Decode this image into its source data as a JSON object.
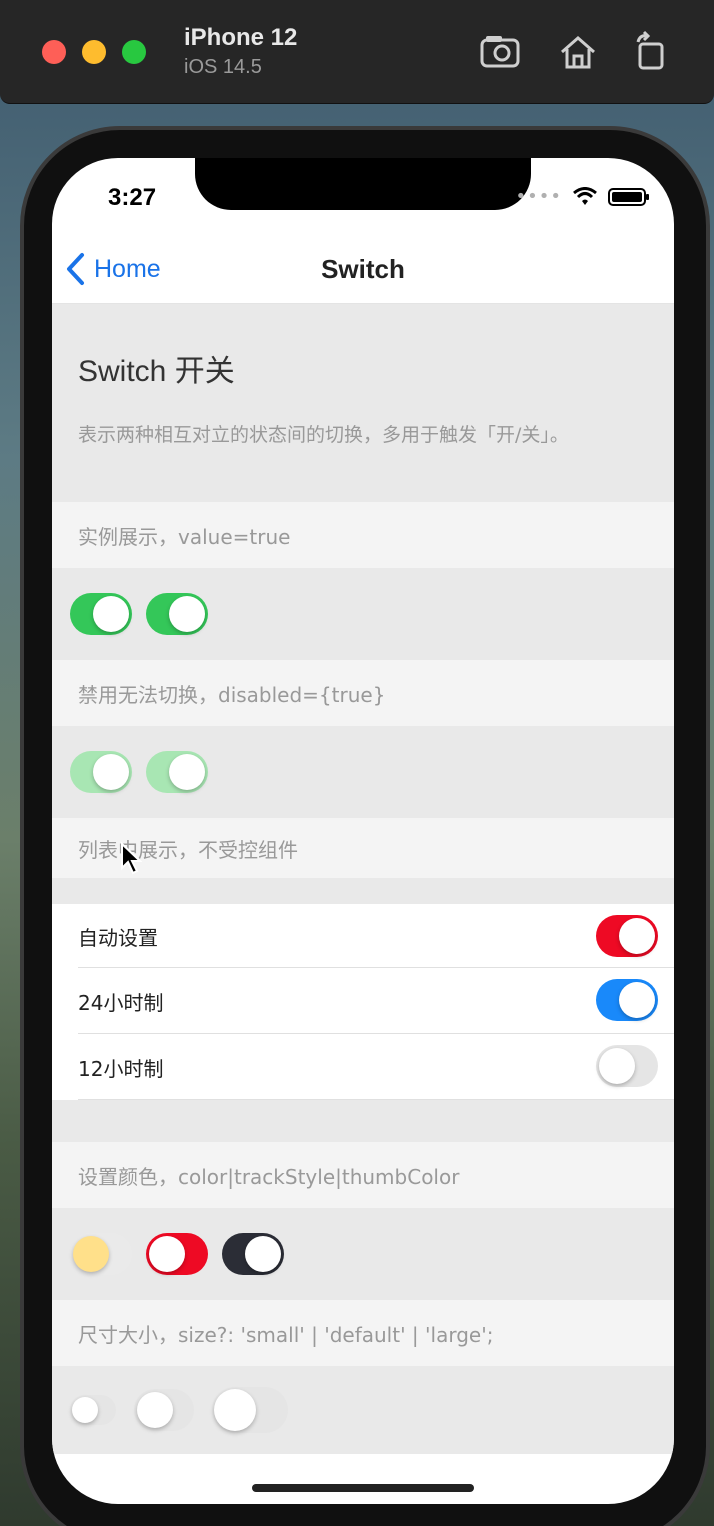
{
  "simulator": {
    "device": "iPhone 12",
    "os": "iOS 14.5"
  },
  "status_bar": {
    "time": "3:27"
  },
  "navbar": {
    "back_label": "Home",
    "title": "Switch"
  },
  "hero": {
    "title": "Switch 开关",
    "description": "表示两种相互对立的状态间的切换，多用于触发「开/关」。"
  },
  "sections": {
    "basic_label": "实例展示，value=true",
    "disabled_label": "禁用无法切换，disabled={true}",
    "list_label": "列表中展示，不受控组件",
    "color_label": "设置颜色，color|trackStyle|thumbColor",
    "size_label": "尺寸大小，size?: 'small' | 'default' | 'large';"
  },
  "list_items": [
    {
      "label": "自动设置",
      "on": true,
      "color": "#ee0a24"
    },
    {
      "label": "24小时制",
      "on": true,
      "color": "#1989fa"
    },
    {
      "label": "12小时制",
      "on": false,
      "color": "#e5e5e5"
    }
  ],
  "colors": {
    "accent_blue": "#1a73e8",
    "switch_green": "#34c759",
    "switch_red": "#ee0a24",
    "switch_blue": "#1989fa",
    "switch_dark": "#2b2d36",
    "thumb_yellow": "#ffe08a"
  }
}
